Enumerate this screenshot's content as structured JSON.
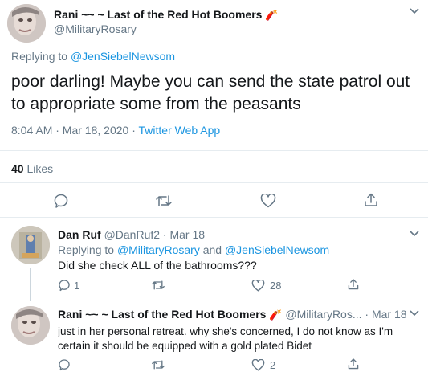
{
  "main_tweet": {
    "author_name": "Rani ~~ ~ Last of the Red Hot Boomers",
    "handle": "@MilitaryRosary",
    "emoji": "🧨",
    "replying_prefix": "Replying to",
    "replying_to": "@JenSiebelNewsom",
    "text": "poor darling! Maybe you can send the state patrol out to appropriate some from the peasants",
    "timestamp": "8:04 AM · Mar 18, 2020 · ",
    "source": "Twitter Web App",
    "likes_count": "40",
    "likes_label": "Likes"
  },
  "reply1": {
    "author_name": "Dan Ruf",
    "handle": "@DanRuf2",
    "date": "· Mar 18",
    "replying_prefix": "Replying to",
    "replying_to_1": "@MilitaryRosary",
    "and": "and",
    "replying_to_2": "@JenSiebelNewsom",
    "text": "Did she check ALL of the bathrooms???",
    "reply_count": "1",
    "retweet_count": "",
    "like_count": "28"
  },
  "reply2": {
    "author_name": "Rani ~~ ~ Last of the Red Hot Boomers",
    "emoji": "🧨",
    "handle": "@MilitaryRos...",
    "date": "· Mar 18",
    "text_line1": "just in her personal retreat. why she's concerned, I do not know as I'm",
    "text_line2": "certain it should be equipped with a gold plated Bidet",
    "reply_count": "",
    "retweet_count": "",
    "like_count": "2"
  },
  "colors": {
    "link": "#1b95e0",
    "muted": "#657786",
    "divider": "#e6ecf0"
  }
}
